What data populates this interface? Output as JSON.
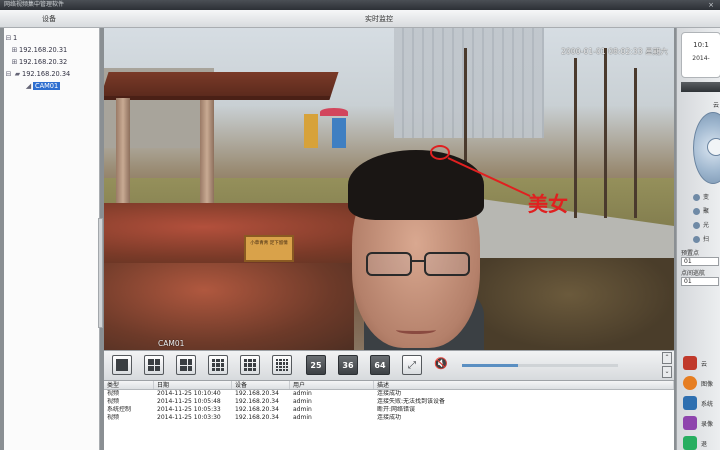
{
  "app": {
    "title": "网络视频集中管理软件",
    "close_label": "×"
  },
  "header": {
    "devices_label": "设备",
    "monitor_label": "实时监控"
  },
  "tree": {
    "root": "1",
    "items": [
      {
        "label": "192.168.20.31"
      },
      {
        "label": "192.168.20.32"
      },
      {
        "label": "192.168.20.34"
      },
      {
        "label": "CAM01"
      }
    ]
  },
  "video": {
    "osd_time": "2000-01-01 08:02:33 星期六",
    "osd_cam": "CAM01",
    "sign_text": "小草青青 足下留情",
    "annotation": "美女",
    "annotation_color": "#e02020"
  },
  "toolbar": {
    "buttons": [
      "1",
      "4",
      "6",
      "8",
      "9",
      "16",
      "25",
      "36",
      "64"
    ],
    "volume_level": 0.36
  },
  "log": {
    "columns": [
      "类型",
      "日期",
      "设备",
      "用户",
      "描述"
    ],
    "rows": [
      [
        "视频",
        "2014-11-25 10:10:40",
        "192.168.20.34",
        "admin",
        "连接成功"
      ],
      [
        "视频",
        "2014-11-25 10:05:48",
        "192.168.20.34",
        "admin",
        "连接失败:无法找到该设备"
      ],
      [
        "系统控制",
        "2014-11-25 10:05:33",
        "192.168.20.34",
        "admin",
        "断开:网络错误"
      ],
      [
        "视频",
        "2014-11-25 10:03:30",
        "192.168.20.34",
        "admin",
        "连接成功"
      ]
    ]
  },
  "rpanel": {
    "time": "10:1",
    "date": "2014-",
    "ptz_label": "云",
    "rows": [
      "变",
      "聚",
      "光",
      "扫"
    ],
    "preset_label": "预置点",
    "preset_value": "01",
    "cruise_label": "点间巡航",
    "cruise_value": "01",
    "buttons": [
      "云",
      "图像",
      "系统",
      "录像",
      "退"
    ]
  }
}
